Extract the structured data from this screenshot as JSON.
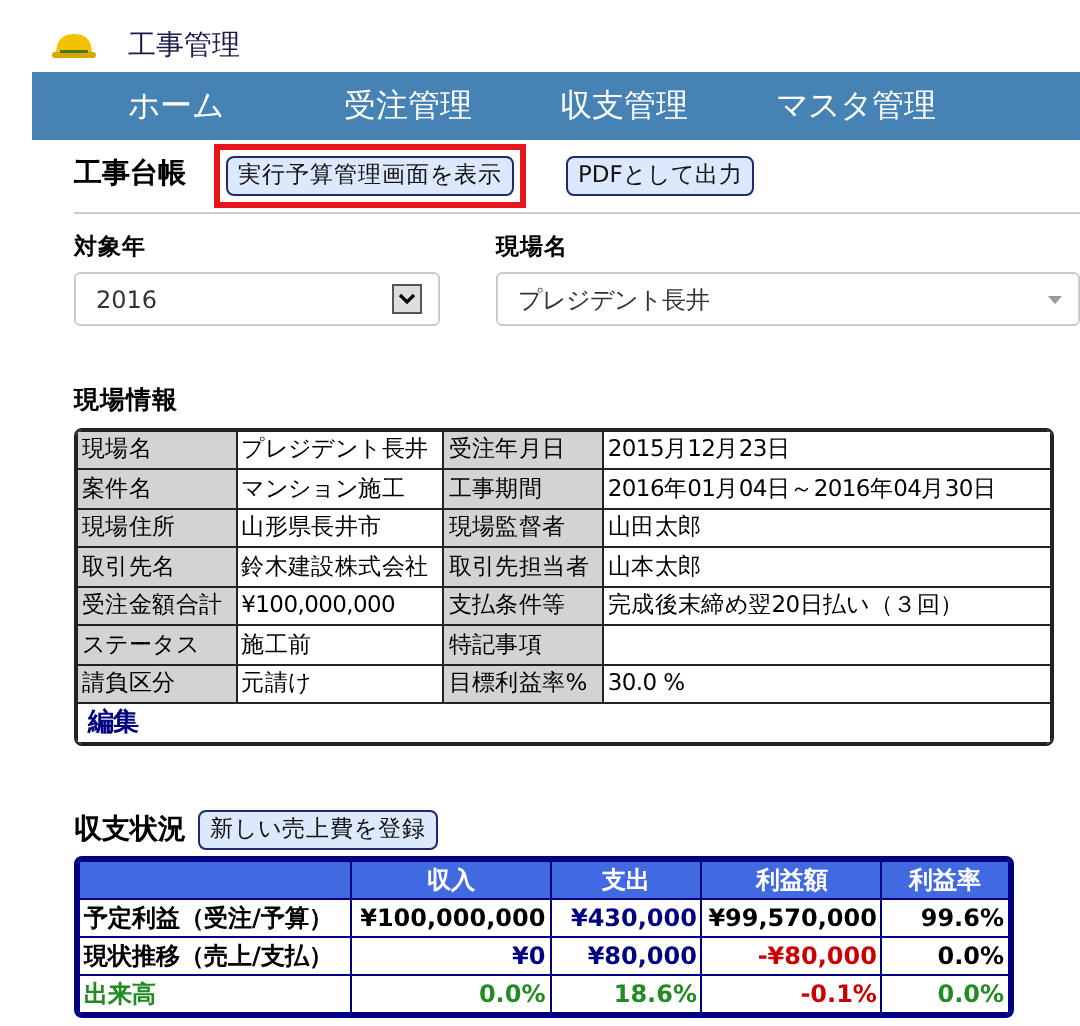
{
  "app": {
    "title": "工事管理"
  },
  "nav": [
    {
      "label": "ホーム"
    },
    {
      "label": "受注管理"
    },
    {
      "label": "収支管理"
    },
    {
      "label": "マスタ管理"
    }
  ],
  "ledger": {
    "title": "工事台帳",
    "buttons": [
      {
        "label": "実行予算管理画面を表示",
        "highlighted": true
      },
      {
        "label": "PDFとして出力",
        "highlighted": false
      }
    ]
  },
  "filters": [
    {
      "label": "対象年",
      "value": "2016",
      "kind": "select"
    },
    {
      "label": "現場名",
      "value": "プレジデント長井",
      "kind": "combo"
    }
  ],
  "site_info": {
    "title": "現場情報",
    "rows": [
      [
        "現場名",
        "プレジデント長井",
        "受注年月日",
        "2015月12月23日"
      ],
      [
        "案件名",
        "マンション施工",
        "工事期間",
        "2016年01月04日～2016年04月30日"
      ],
      [
        "現場住所",
        "山形県長井市",
        "現場監督者",
        "山田太郎"
      ],
      [
        "取引先名",
        "鈴木建設株式会社",
        "取引先担当者",
        "山本太郎"
      ],
      [
        "受注金額合計",
        "¥100,000,000",
        "支払条件等",
        "完成後末締め翌20日払い（３回）"
      ],
      [
        "ステータス",
        "施工前",
        "特記事項",
        ""
      ],
      [
        "請負区分",
        "元請け",
        "目標利益率%",
        "30.0 %"
      ]
    ],
    "edit_link": "編集"
  },
  "balance": {
    "title": "収支状況",
    "button": "新しい売上費を登録",
    "columns": [
      "収入",
      "支出",
      "利益額",
      "利益率"
    ],
    "rows": [
      {
        "label": "予定利益（受注/予算）",
        "kind": "actual",
        "cells": [
          {
            "text": "¥100,000,000",
            "color": "#000000"
          },
          {
            "text": "¥430,000",
            "color": "#000080"
          },
          {
            "text": "¥99,570,000",
            "color": "#000000"
          },
          {
            "text": "99.6%",
            "color": "#000000"
          }
        ]
      },
      {
        "label": "現状推移（売上/支払）",
        "kind": "actual",
        "cells": [
          {
            "text": "¥0",
            "color": "#000080"
          },
          {
            "text": "¥80,000",
            "color": "#000080"
          },
          {
            "text": "-¥80,000",
            "color": "#cc0000"
          },
          {
            "text": "0.0%",
            "color": "#000000"
          }
        ]
      },
      {
        "label": "出来高",
        "kind": "progress",
        "cells": [
          {
            "text": "0.0%",
            "color": "#228b22"
          },
          {
            "text": "18.6%",
            "color": "#228b22"
          },
          {
            "text": "-0.1%",
            "color": "#cc0000"
          },
          {
            "text": "0.0%",
            "color": "#228b22"
          }
        ]
      }
    ]
  }
}
